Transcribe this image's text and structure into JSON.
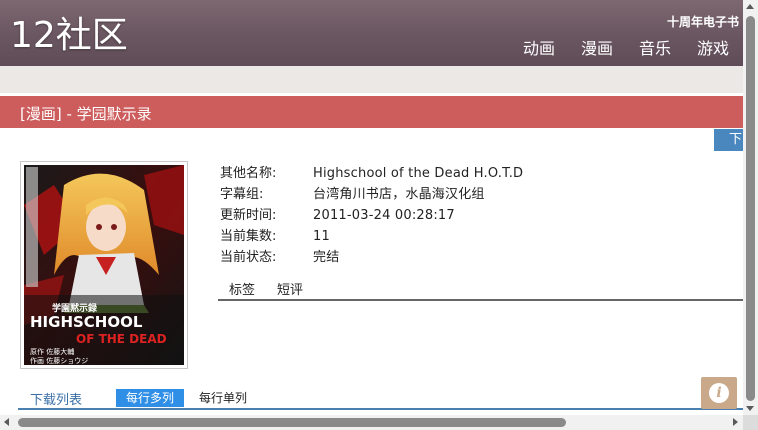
{
  "header": {
    "logo": "12社区",
    "anniversary": "十周年电子书",
    "nav": [
      "动画",
      "漫画",
      "音乐",
      "游戏"
    ]
  },
  "title_bar": {
    "title": "[漫画] - 学园默示录"
  },
  "download_tab": "下",
  "cover": {
    "title_lines": [
      "学園黙示録",
      "HIGHSCHOOL",
      "OF THE DEAD"
    ],
    "credit_lines": [
      "原作 佐藤大輔",
      "作画 佐藤ショウジ"
    ]
  },
  "info": {
    "rows": [
      {
        "label": "其他名称:",
        "value": "Highschool of the Dead H.O.T.D"
      },
      {
        "label": "字幕组:",
        "value": "台湾角川书店，水晶海汉化组"
      },
      {
        "label": "更新时间:",
        "value": "2011-03-24 00:28:17"
      },
      {
        "label": "当前集数:",
        "value": "11"
      },
      {
        "label": "当前状态:",
        "value": "完结"
      }
    ]
  },
  "tabs": [
    "标签",
    "短评"
  ],
  "download_list": {
    "title": "下载列表",
    "multi_label": "每行多列",
    "single_label": "每行单列"
  },
  "info_float_glyph": "i",
  "colors": {
    "header": "#6a5660",
    "title_bar": "#cd5c5c",
    "accent_blue": "#2f8fe6",
    "link_blue": "#3a6fa8",
    "info_button": "#c9a98a"
  }
}
